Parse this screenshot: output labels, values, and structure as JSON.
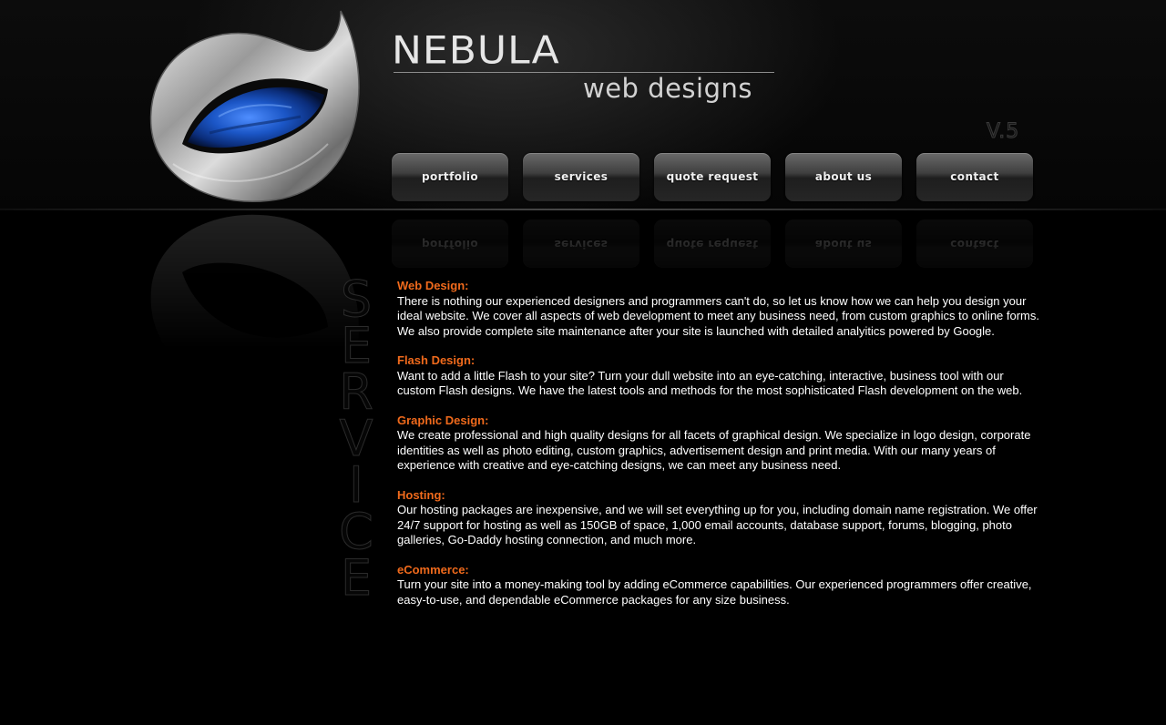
{
  "brand": {
    "name": "NEBULA",
    "tagline": "web designs",
    "version": "V.5"
  },
  "nav": {
    "items": [
      {
        "label": "portfolio"
      },
      {
        "label": "services"
      },
      {
        "label": "quote request"
      },
      {
        "label": "about us"
      },
      {
        "label": "contact"
      }
    ]
  },
  "watermark": {
    "letters": [
      "S",
      "E",
      "R",
      "V",
      "I",
      "C",
      "E"
    ]
  },
  "content": {
    "sections": [
      {
        "title": "Web Design:",
        "body": "There is nothing our experienced designers and programmers can't do, so let us know how we can help you design your ideal website. We cover all aspects of web development to meet any business need, from custom graphics to online forms. We also provide complete site maintenance after your site is launched with detailed analyitics powered by Google."
      },
      {
        "title": "Flash Design:",
        "body": "Want to add a little Flash to your site? Turn your dull website into an eye-catching, interactive, business tool with our custom Flash designs. We have the latest tools and methods for the most sophisticated Flash development on the web."
      },
      {
        "title": "Graphic Design:",
        "body": "We create professional and high quality designs for all facets of graphical design. We specialize in logo design, corporate identities as well as photo editing, custom graphics, advertisement design and print media. With our many years of experience with creative and eye-catching designs, we can meet any business need."
      },
      {
        "title": "Hosting:",
        "body": "Our hosting packages are inexpensive, and we will set everything up for you, including domain name registration. We offer 24/7 support for hosting as well as 150GB of space, 1,000 email accounts, database support, forums, blogging, photo galleries, Go-Daddy hosting connection, and much more."
      },
      {
        "title": "eCommerce:",
        "body": "Turn your site into a money-making tool by adding eCommerce capabilities. Our experienced programmers offer creative, easy-to-use, and dependable eCommerce packages for any size business."
      }
    ]
  },
  "colors": {
    "background": "#000000",
    "heading": "#f06a1c",
    "body_text": "#ffffff",
    "logo_eye": "#1f5fc4"
  },
  "icons": {
    "logo": "nebula-eye-logo-icon"
  }
}
